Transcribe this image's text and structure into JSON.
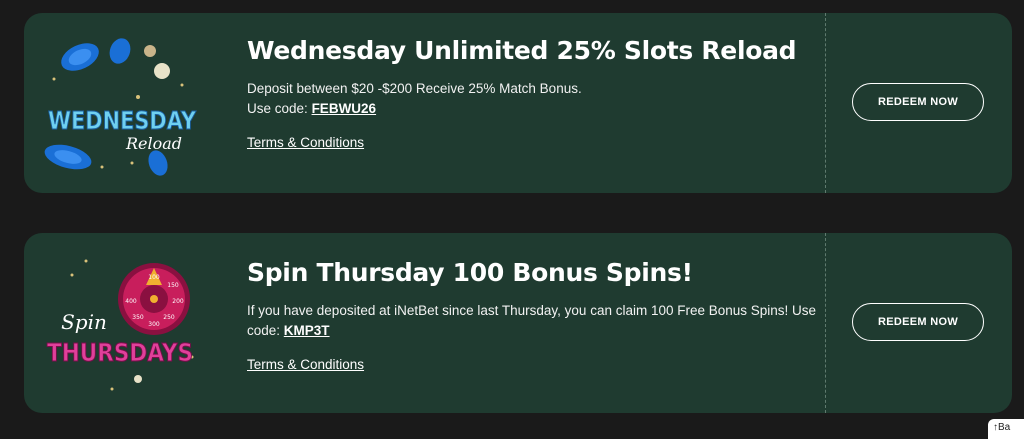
{
  "promotions": [
    {
      "logo_text": "WEDNESDAY",
      "logo_script": "Reload",
      "title": "Wednesday Unlimited 25% Slots Reload",
      "description": "Deposit between $20 -$200 Receive 25% Match Bonus.",
      "code_prefix": "Use code:",
      "code": "FEBWU26",
      "terms_label": "Terms & Conditions",
      "button_label": "REDEEM NOW"
    },
    {
      "logo_script": "Spin",
      "logo_text": "THURSDAYS",
      "wheel_labels": [
        "100",
        "150",
        "200",
        "250",
        "300",
        "350",
        "400"
      ],
      "title": "Spin Thursday 100 Bonus Spins!",
      "description": "If you have deposited at iNetBet since last Thursday, you can claim 100 Free Bonus Spins! Use",
      "code_prefix": "code:",
      "code": "KMP3T",
      "terms_label": "Terms & Conditions",
      "button_label": "REDEEM NOW"
    }
  ],
  "back_to_top": {
    "icon": "arrow-up-icon",
    "label": "Ba"
  },
  "colors": {
    "background": "#1a1a1a",
    "card": "#1f3b30",
    "wednesday_logo": "#6fd0f0",
    "thursday_logo": "#e0409a"
  }
}
